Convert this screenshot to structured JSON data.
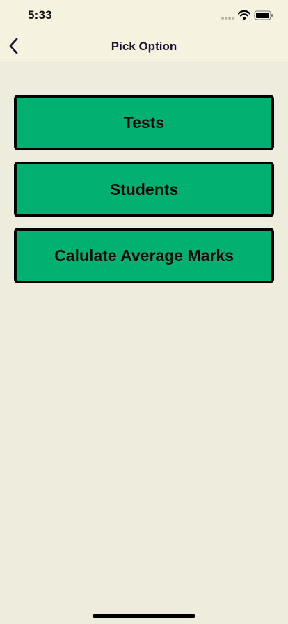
{
  "status_bar": {
    "time": "5:33",
    "signal_icon": "signal-dots-icon",
    "wifi_icon": "wifi-icon",
    "battery_icon": "battery-icon"
  },
  "nav": {
    "back_icon": "chevron-left-icon",
    "title": "Pick Option"
  },
  "menu": {
    "items": [
      {
        "label": "Tests"
      },
      {
        "label": "Students"
      },
      {
        "label": "Calulate Average Marks"
      }
    ]
  },
  "colors": {
    "background": "#eeecdd",
    "header": "#f6f2e0",
    "button": "#02b071",
    "button_border": "#000000",
    "title_text": "#1d1230"
  }
}
